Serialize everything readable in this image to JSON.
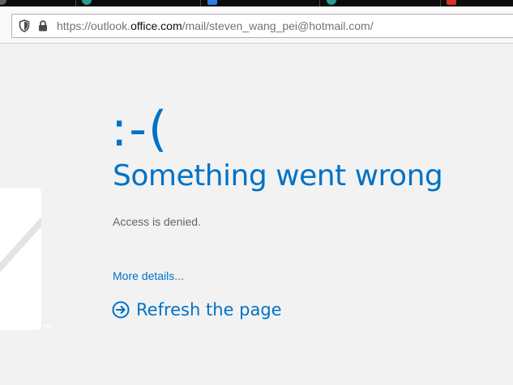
{
  "browser": {
    "url_prefix": "https://outlook.",
    "url_host": "office.com",
    "url_path": "/mail/steven_wang_pei@hotmail.com/"
  },
  "error": {
    "emoticon": ":-(",
    "title": "Something went wrong",
    "message": "Access is denied.",
    "details_link": "More details...",
    "refresh_label": "Refresh the page"
  },
  "logo": {
    "trademark": "TM"
  },
  "colors": {
    "accent": "#0072c6",
    "message_text": "#666666",
    "page_background": "#f2f2f2"
  },
  "icons": {
    "tracking_protection": "shield-icon",
    "connection": "lock-icon",
    "refresh": "circle-arrow-right-icon"
  }
}
